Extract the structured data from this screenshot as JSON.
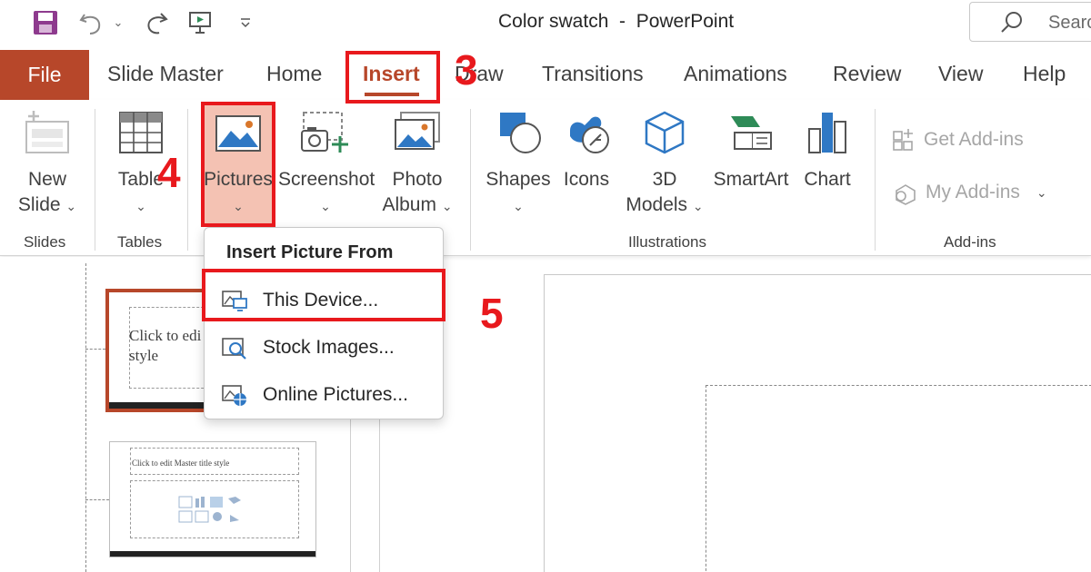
{
  "titlebar": {
    "title": "Color swatch  -  PowerPoint",
    "search_placeholder": "Search"
  },
  "tabs": [
    "File",
    "Slide Master",
    "Home",
    "Insert",
    "Draw",
    "Transitions",
    "Animations",
    "Review",
    "View",
    "Help"
  ],
  "active_tab": "Insert",
  "ribbon": {
    "new_slide": "New",
    "new_slide2": "Slide",
    "table": "Table",
    "pictures": "Pictures",
    "screenshot": "Screenshot",
    "photo_album1": "Photo",
    "photo_album2": "Album",
    "shapes": "Shapes",
    "icons": "Icons",
    "models1": "3D",
    "models2": "Models",
    "smartart": "SmartArt",
    "chart": "Chart",
    "get_addins": "Get Add-ins",
    "my_addins": "My Add-ins",
    "groups": {
      "slides": "Slides",
      "tables": "Tables",
      "illustrations": "Illustrations",
      "addins": "Add-ins"
    }
  },
  "dropdown": {
    "header": "Insert Picture From",
    "items": [
      "This Device...",
      "Stock Images...",
      "Online Pictures..."
    ]
  },
  "annotations": {
    "step3": "3",
    "step4": "4",
    "step5": "5"
  },
  "thumbnails": {
    "thumb1_line1": "Click to edi",
    "thumb1_line2": "style",
    "thumb2_title": "Click to edit Master title style"
  },
  "colors": {
    "accent": "#b7472a",
    "annotation_red": "#e8191d",
    "save_purple": "#8e3a8e"
  }
}
